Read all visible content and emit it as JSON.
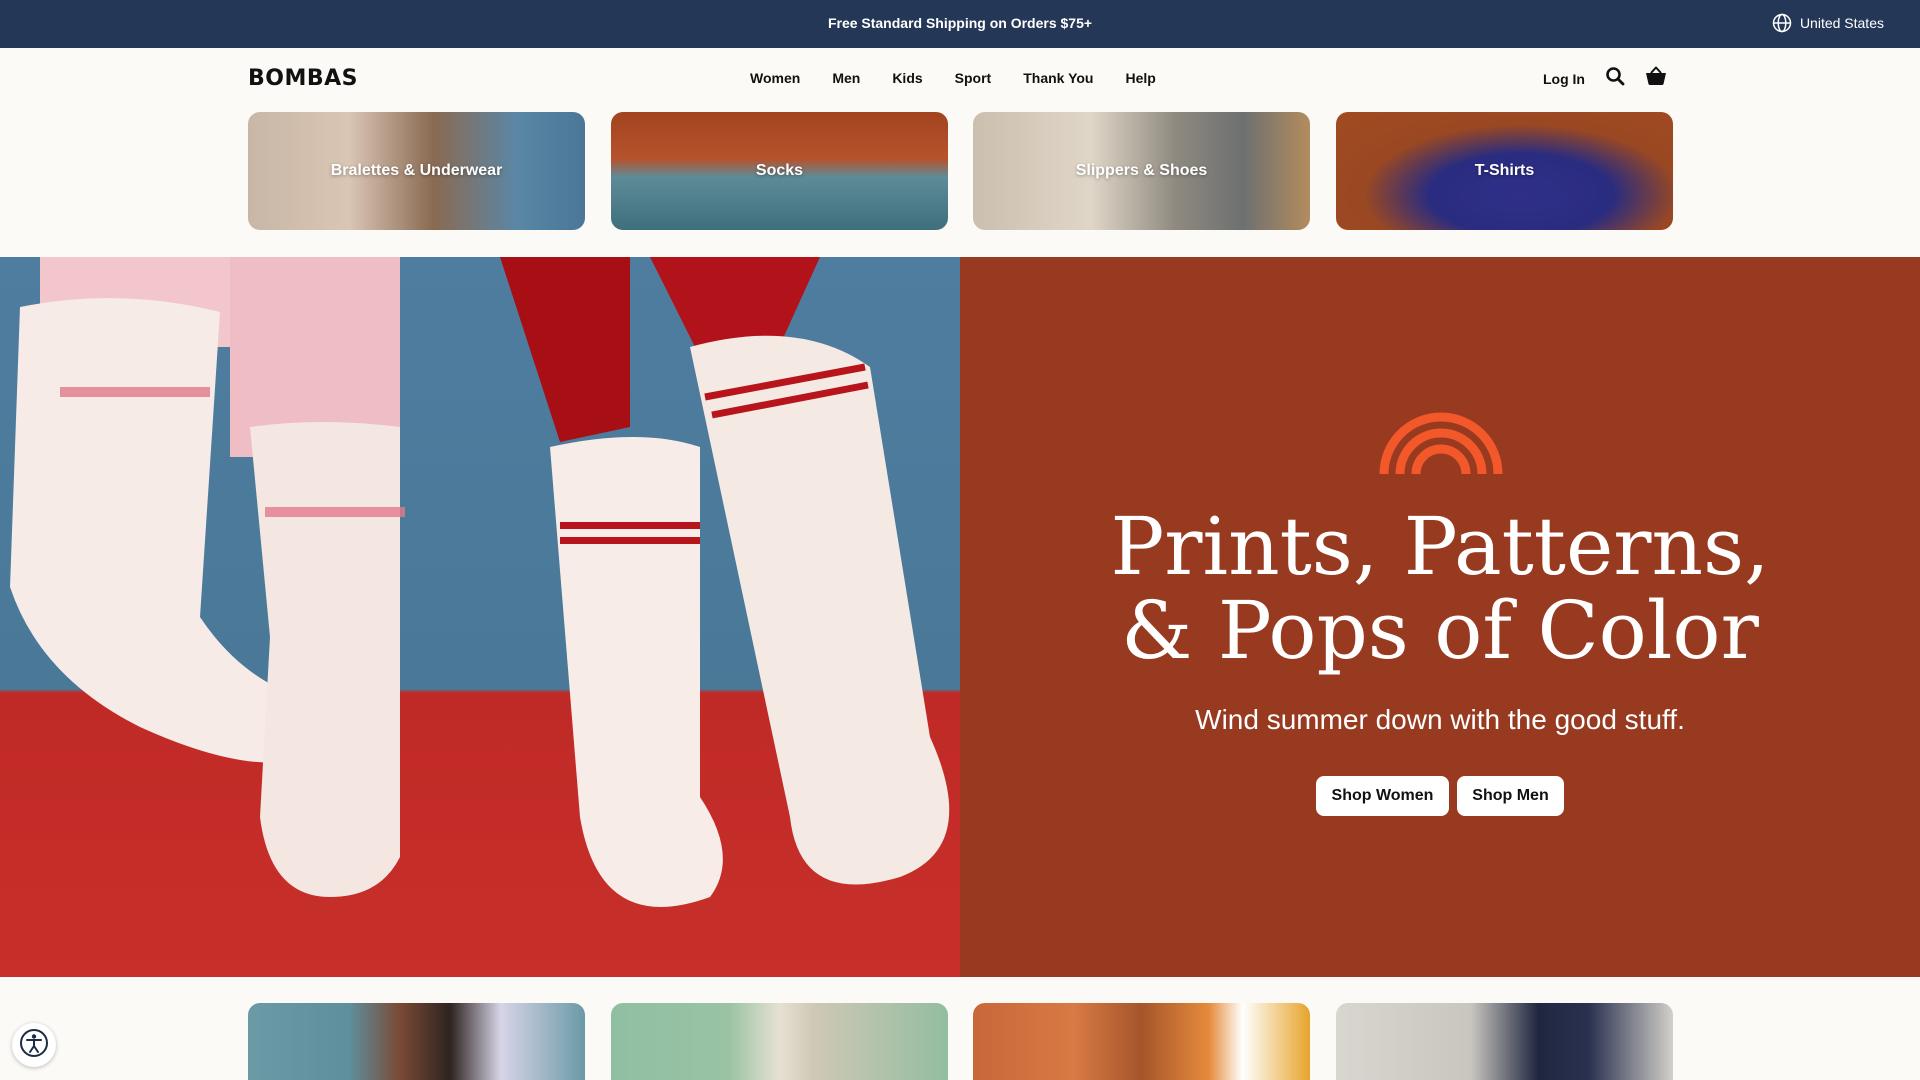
{
  "announcement": {
    "text": "Free Standard Shipping on Orders $75+",
    "region": "United States"
  },
  "header": {
    "logo": "BOMBAS",
    "nav": [
      "Women",
      "Men",
      "Kids",
      "Sport",
      "Thank You",
      "Help"
    ],
    "login": "Log In"
  },
  "categories": [
    {
      "label": "Bralettes & Underwear"
    },
    {
      "label": "Socks"
    },
    {
      "label": "Slippers & Shoes"
    },
    {
      "label": "T-Shirts"
    }
  ],
  "hero": {
    "title_line1": "Prints, Patterns,",
    "title_line2": "& Pops of Color",
    "subtitle": "Wind summer down with the good stuff.",
    "btn_women": "Shop Women",
    "btn_men": "Shop Men",
    "panel_color": "#983a20",
    "accent_color": "#f2582a"
  },
  "icons": [
    "globe-icon",
    "search-icon",
    "cart-icon",
    "rainbow-icon",
    "accessibility-icon"
  ]
}
